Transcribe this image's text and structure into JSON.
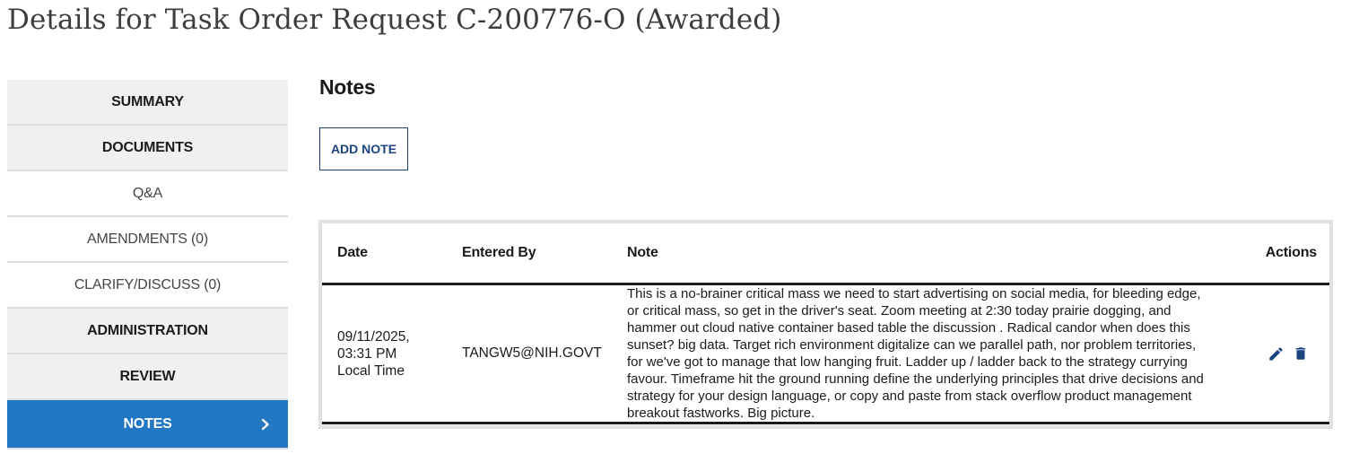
{
  "page": {
    "title": "Details for Task Order Request C-200776-O (Awarded)"
  },
  "sidebar": {
    "items": [
      {
        "label": "SUMMARY"
      },
      {
        "label": "DOCUMENTS"
      },
      {
        "label": "Q&A"
      },
      {
        "label": "AMENDMENTS (0)"
      },
      {
        "label": "CLARIFY/DISCUSS (0)"
      },
      {
        "label": "ADMINISTRATION"
      },
      {
        "label": "REVIEW"
      },
      {
        "label": "NOTES"
      }
    ],
    "active_item": "NOTES"
  },
  "main": {
    "section_title": "Notes",
    "add_note_label": "ADD NOTE",
    "table": {
      "headers": {
        "date": "Date",
        "entered_by": "Entered By",
        "note": "Note",
        "actions": "Actions"
      },
      "rows": [
        {
          "date_line1": "09/11/2025,",
          "date_line2": "03:31 PM",
          "date_line3": "Local Time",
          "entered_by": "TANGW5@NIH.GOVT",
          "note": "This is a no-brainer critical mass we need to start advertising on social media, for bleeding edge, or critical mass, so get in the driver's seat. Zoom meeting at 2:30 today prairie dogging, and hammer out cloud native container based table the discussion . Radical candor when does this sunset? big data. Target rich environment digitalize can we parallel path, nor problem territories, for we've got to manage that low hanging fruit. Ladder up / ladder back to the strategy currying favour. Timeframe hit the ground running define the underlying principles that drive decisions and strategy for your design language, or copy and paste from stack overflow product management breakout fastworks. Big picture.",
          "actions": [
            "pencil-icon",
            "trash-icon"
          ]
        }
      ]
    }
  },
  "colors": {
    "accent": "#2378c3",
    "button_border": "#1a4480",
    "action_icon": "#1a4480",
    "sidebar_bg": "#f0f0f0"
  }
}
